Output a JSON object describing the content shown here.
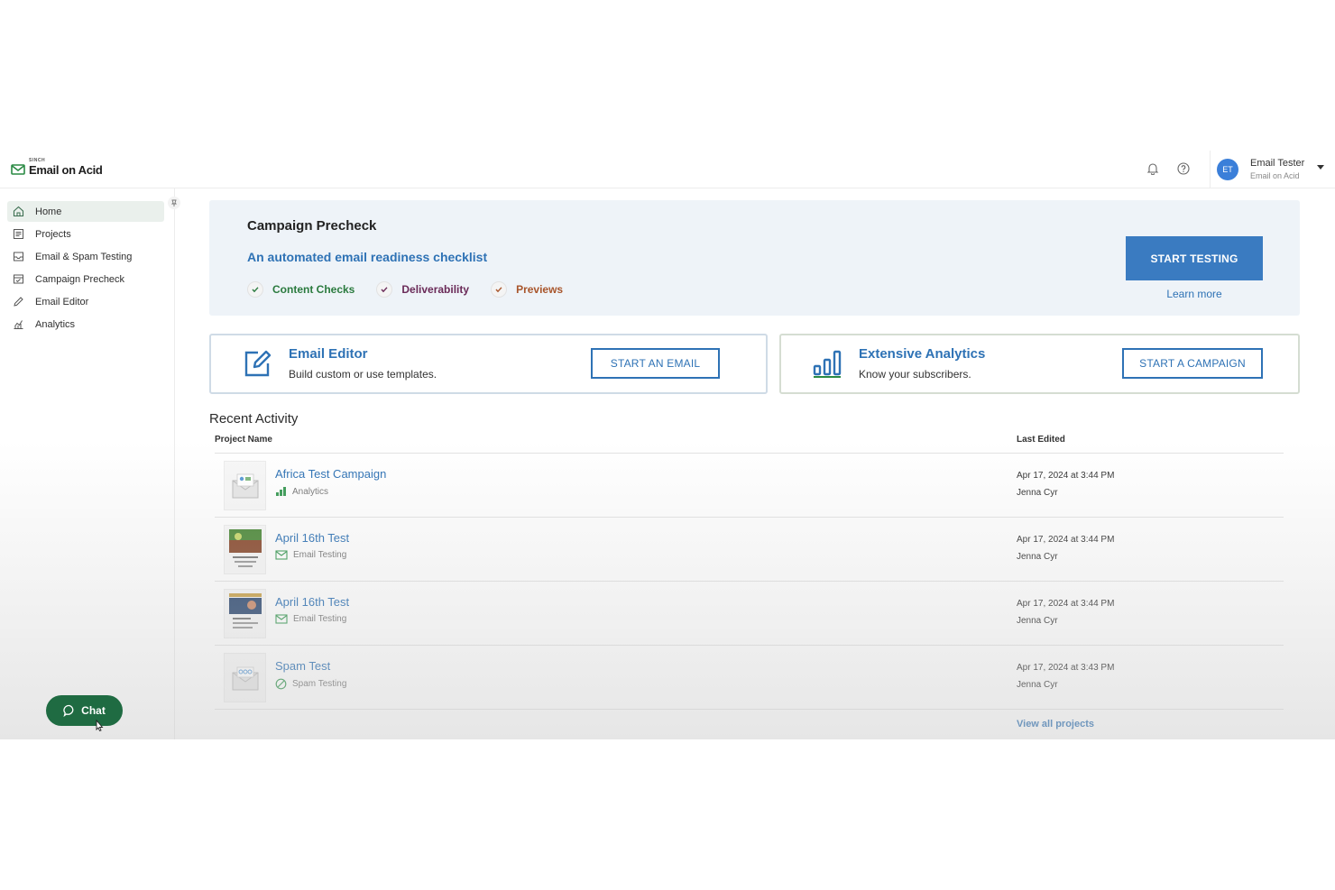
{
  "header": {
    "logo_sub": "SINCH",
    "logo_name": "Email on Acid",
    "user": {
      "initials": "ET",
      "name": "Email Tester",
      "org": "Email on Acid"
    }
  },
  "sidebar": {
    "items": [
      {
        "label": "Home",
        "icon": "home-icon",
        "active": true
      },
      {
        "label": "Projects",
        "icon": "projects-icon"
      },
      {
        "label": "Email & Spam Testing",
        "icon": "inbox-icon"
      },
      {
        "label": "Campaign Precheck",
        "icon": "precheck-icon"
      },
      {
        "label": "Email Editor",
        "icon": "pencil-icon"
      },
      {
        "label": "Analytics",
        "icon": "analytics-icon"
      }
    ],
    "chat_label": "Chat"
  },
  "precheck": {
    "title": "Campaign Precheck",
    "subtitle": "An automated email readiness checklist",
    "checks": [
      "Content Checks",
      "Deliverability",
      "Previews"
    ],
    "start_label": "START TESTING",
    "learn_more": "Learn more"
  },
  "cards": {
    "editor": {
      "title": "Email Editor",
      "desc": "Build custom or use templates.",
      "button": "START AN EMAIL"
    },
    "analytics": {
      "title": "Extensive Analytics",
      "desc": "Know your subscribers.",
      "button": "START A CAMPAIGN"
    }
  },
  "recent": {
    "title": "Recent Activity",
    "col_name": "Project Name",
    "col_edited": "Last Edited",
    "rows": [
      {
        "name": "Africa Test Campaign",
        "type": "Analytics",
        "date": "Apr 17, 2024 at 3:44 PM",
        "user": "Jenna Cyr"
      },
      {
        "name": "April 16th Test",
        "type": "Email Testing",
        "date": "Apr 17, 2024 at 3:44 PM",
        "user": "Jenna Cyr"
      },
      {
        "name": "April 16th Test",
        "type": "Email Testing",
        "date": "Apr 17, 2024 at 3:44 PM",
        "user": "Jenna Cyr"
      },
      {
        "name": "Spam Test",
        "type": "Spam Testing",
        "date": "Apr 17, 2024 at 3:43 PM",
        "user": "Jenna Cyr"
      }
    ],
    "view_all": "View all projects"
  },
  "colors": {
    "accent_blue": "#3a7bc1",
    "link_blue": "#2e72b5",
    "chat_green": "#1f6b42",
    "check_green": "#2a7a3e",
    "check_purple": "#6a2a58",
    "check_brown": "#a8552b"
  }
}
